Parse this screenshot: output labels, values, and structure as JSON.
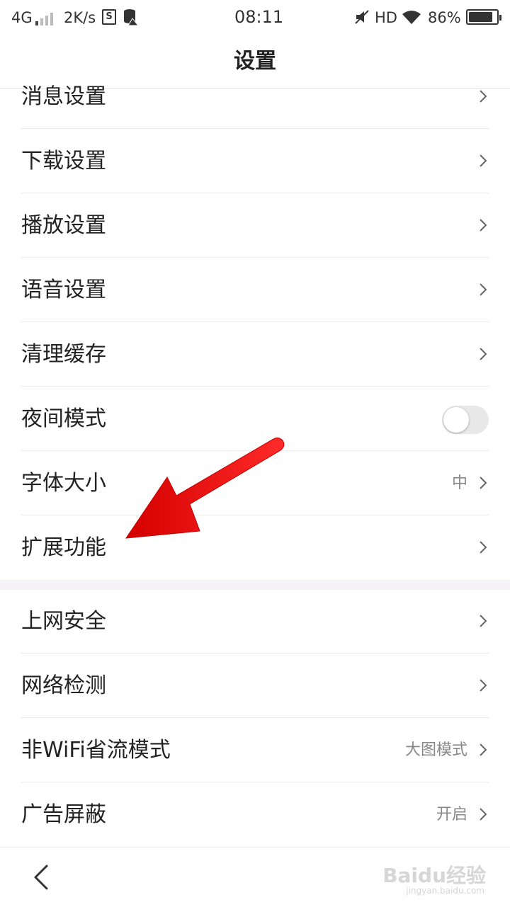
{
  "status_bar": {
    "network": "4G",
    "speed": "2K/s",
    "time": "08:11",
    "hd": "HD",
    "battery": "86%",
    "battery_level": 0.86
  },
  "header": {
    "title": "设置"
  },
  "sections": [
    {
      "items": [
        {
          "label": "消息设置",
          "type": "chevron"
        },
        {
          "label": "下载设置",
          "type": "chevron"
        },
        {
          "label": "播放设置",
          "type": "chevron"
        },
        {
          "label": "语音设置",
          "type": "chevron"
        },
        {
          "label": "清理缓存",
          "type": "chevron"
        },
        {
          "label": "夜间模式",
          "type": "toggle",
          "enabled": false
        },
        {
          "label": "字体大小",
          "type": "chevron",
          "value": "中"
        },
        {
          "label": "扩展功能",
          "type": "chevron"
        }
      ]
    },
    {
      "items": [
        {
          "label": "上网安全",
          "type": "chevron"
        },
        {
          "label": "网络检测",
          "type": "chevron"
        },
        {
          "label": "非WiFi省流模式",
          "type": "chevron",
          "value": "大图模式"
        },
        {
          "label": "广告屏蔽",
          "type": "chevron",
          "value": "开启"
        }
      ]
    }
  ],
  "watermark": {
    "text": "Baidu经验",
    "sub": "jingyan.baidu.com"
  },
  "colors": {
    "annotation_arrow": "#ee1111",
    "section_gap": "#f5f3f7"
  }
}
